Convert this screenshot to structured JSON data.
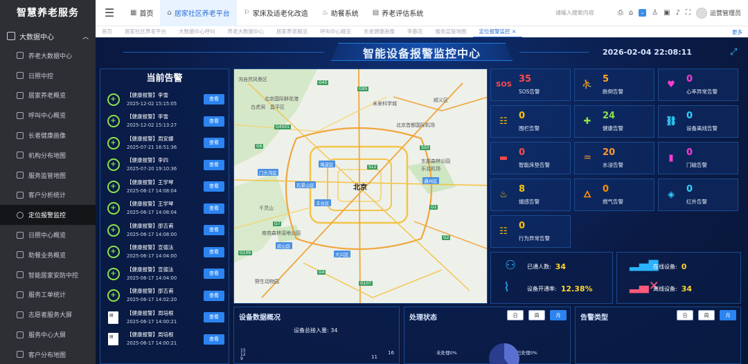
{
  "sidebar": {
    "logo": "智慧养老服务",
    "group": "大数据中心",
    "items": [
      {
        "label": "养老大数据中心",
        "icon": "chart-icon"
      },
      {
        "label": "日照中控",
        "icon": "document-icon"
      },
      {
        "label": "居家养老概览",
        "icon": "document-icon"
      },
      {
        "label": "呼叫中心概览",
        "icon": "document-icon"
      },
      {
        "label": "长者健康画像",
        "icon": "chart-icon"
      },
      {
        "label": "机构分布地图",
        "icon": "chart-icon"
      },
      {
        "label": "服务监管地图",
        "icon": "document-icon"
      },
      {
        "label": "客户分析统计",
        "icon": "document-icon"
      },
      {
        "label": "定位报警监控",
        "icon": "location-icon",
        "active": true
      },
      {
        "label": "日照中心概览",
        "icon": "document-icon"
      },
      {
        "label": "助餐业务概览",
        "icon": "document-icon"
      },
      {
        "label": "智能居家安防中控",
        "icon": "chart-icon"
      },
      {
        "label": "服务工单统计",
        "icon": "document-icon"
      },
      {
        "label": "志愿者服务大屏",
        "icon": "document-icon"
      },
      {
        "label": "服务中心大屏",
        "icon": "document-icon"
      },
      {
        "label": "客户分布地图",
        "icon": "document-icon"
      }
    ]
  },
  "topbar": {
    "tabs": [
      {
        "label": "首页",
        "active": false
      },
      {
        "label": "居家社区养老平台",
        "active": true
      },
      {
        "label": "家床及适老化改造",
        "active": false
      },
      {
        "label": "助餐系统",
        "active": false
      },
      {
        "label": "养老评估系统",
        "active": false
      }
    ],
    "search_placeholder": "请输入搜索内容",
    "user": "运营管理员"
  },
  "tabstrip": {
    "tabs": [
      "首页",
      "居家社区养老平台",
      "大数据中心呼叫",
      "养老大数据中心",
      "居家养老概览",
      "呼叫中心概览",
      "长者健康画像",
      "李春花",
      "服务监管地图",
      "定位报警监控"
    ],
    "active_index": 9,
    "more": "更多"
  },
  "dashboard": {
    "title": "智能设备报警监控中心",
    "datetime": "2026-02-04 22:08:11"
  },
  "alerts": {
    "title": "当前告警",
    "button_label": "查看",
    "items": [
      {
        "tag": "【健康报警】",
        "name": "李雪",
        "time": "2025-12-02 15:15:05",
        "icon": "health-icon"
      },
      {
        "tag": "【健康报警】",
        "name": "李雪",
        "time": "2025-12-02 15:13:27",
        "icon": "health-icon"
      },
      {
        "tag": "【健康报警】",
        "name": "周安娜",
        "time": "2025-07-21 16:51:36",
        "icon": "health-icon"
      },
      {
        "tag": "【健康报警】",
        "name": "李四",
        "time": "2025-07-20 19:10:36",
        "icon": "health-icon"
      },
      {
        "tag": "【健康报警】",
        "name": "王学琴",
        "time": "2025-06-17 14:08:04",
        "icon": "health-icon"
      },
      {
        "tag": "【健康报警】",
        "name": "王学琴",
        "time": "2025-06-17 14:08:04",
        "icon": "health-icon"
      },
      {
        "tag": "【健康报警】",
        "name": "邵吉甫",
        "time": "2025-06-17 14:08:00",
        "icon": "health-icon"
      },
      {
        "tag": "【健康报警】",
        "name": "宣德法",
        "time": "2025-06-17 14:04:00",
        "icon": "health-icon"
      },
      {
        "tag": "【健康报警】",
        "name": "宣德法",
        "time": "2025-06-17 14:04:00",
        "icon": "health-icon"
      },
      {
        "tag": "【健康报警】",
        "name": "邵吉甫",
        "time": "2025-06-17 14:02:20",
        "icon": "health-icon"
      },
      {
        "tag": "【健康报警】",
        "name": "周培根",
        "time": "2025-06-17 14:00:21",
        "icon": "document-icon"
      },
      {
        "tag": "【健康报警】",
        "name": "周培根",
        "time": "2025-06-17 14:00:21",
        "icon": "document-icon"
      }
    ]
  },
  "map": {
    "city": "北京",
    "labels": [
      "沟自然风景区",
      "北京国际鲜花港",
      "昌平区",
      "白虎涧",
      "景区",
      "未来科学城",
      "顺义区",
      "北京首都国际机场",
      "门头沟区",
      "海淀区",
      "北京",
      "东部森林公园",
      "乐北机场",
      "石景山区",
      "丰台区",
      "通州区",
      "千灵山",
      "大兴区",
      "南苑森林湿地公园",
      "房山区",
      "野生动物园",
      "G45",
      "G4501",
      "G1",
      "G6",
      "G95",
      "G2",
      "G4",
      "S12",
      "S50",
      "G7",
      "G109",
      "G107"
    ]
  },
  "stats": {
    "cards": [
      {
        "value": "35",
        "name": "SOS告警",
        "icon": "sos-icon",
        "color": "#ff4b4b"
      },
      {
        "value": "5",
        "name": "跌倒告警",
        "icon": "fall-icon",
        "color": "#ffa726"
      },
      {
        "value": "0",
        "name": "心率异常告警",
        "icon": "heart-icon",
        "color": "#ff3bd2"
      },
      {
        "value": "0",
        "name": "围栏告警",
        "icon": "fence-icon",
        "color": "#ffc400"
      },
      {
        "value": "24",
        "name": "健康告警",
        "icon": "health-icon",
        "color": "#8ee34a"
      },
      {
        "value": "0",
        "name": "设备离线告警",
        "icon": "offline-icon",
        "color": "#2fd4ff"
      },
      {
        "value": "0",
        "name": "智能床垫告警",
        "icon": "bed-icon",
        "color": "#ff4b4b"
      },
      {
        "value": "20",
        "name": "水浸告警",
        "icon": "water-icon",
        "color": "#ff9a2e"
      },
      {
        "value": "0",
        "name": "门磁告警",
        "icon": "door-icon",
        "color": "#ff3bd2"
      },
      {
        "value": "8",
        "name": "烟感告警",
        "icon": "smoke-icon",
        "color": "#ffc400"
      },
      {
        "value": "0",
        "name": "燃气告警",
        "icon": "gas-icon",
        "color": "#ff8f00"
      },
      {
        "value": "0",
        "name": "红外告警",
        "icon": "infrared-icon",
        "color": "#2fd4ff"
      },
      {
        "value": "0",
        "name": "行为异常告警",
        "icon": "behavior-icon",
        "color": "#ffc400"
      }
    ]
  },
  "summary": {
    "connected_label": "已通人数:",
    "connected_value": "34",
    "rate_label": "设备开通率:",
    "rate_value": "12.38%",
    "online_label": "在线设备:",
    "online_value": "0",
    "offline_label": "离线设备:",
    "offline_value": "34"
  },
  "device_panel": {
    "title": "设备数据概况",
    "total_label": "设备总接入量:",
    "total_value": "34",
    "axis_ticks": [
      "15",
      "12",
      "9"
    ],
    "bar_labels": [
      "11",
      "16"
    ]
  },
  "process_panel": {
    "title": "处理状态",
    "segments": [
      "日",
      "周",
      "月"
    ],
    "selected": 2,
    "unprocessed": "未处理0%",
    "processed": "已处理0%"
  },
  "type_panel": {
    "title": "告警类型",
    "segments": [
      "日",
      "周",
      "月"
    ],
    "selected": 2
  }
}
